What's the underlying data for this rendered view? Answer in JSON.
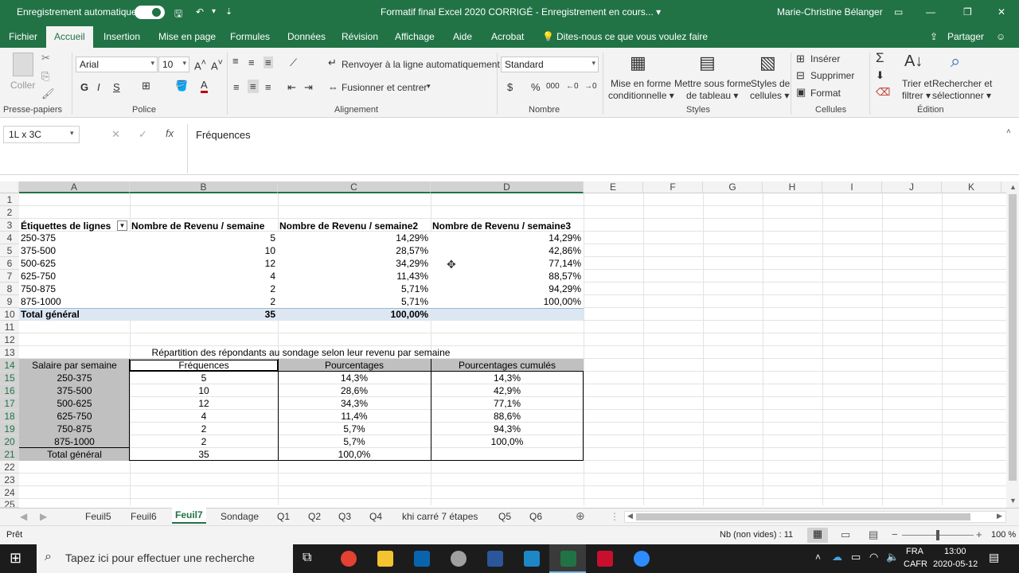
{
  "titlebar": {
    "autosave": "Enregistrement automatique",
    "doc_title": "Formatif final Excel 2020 CORRIGÉ  -  Enregistrement en cours...  ▾",
    "user": "Marie-Christine Bélanger"
  },
  "menu": [
    "Fichier",
    "Accueil",
    "Insertion",
    "Mise en page",
    "Formules",
    "Données",
    "Révision",
    "Affichage",
    "Aide",
    "Acrobat"
  ],
  "tellme": "Dites-nous ce que vous voulez faire",
  "share": "Partager",
  "ribbon": {
    "paste": "Coller",
    "font_name": "Arial",
    "font_size": "10",
    "wrap": "Renvoyer à la ligne automatiquement",
    "merge": "Fusionner et centrer",
    "number_format": "Standard",
    "cond_format": [
      "Mise en forme",
      "conditionnelle ▾"
    ],
    "table_format": [
      "Mettre sous forme",
      "de tableau ▾"
    ],
    "cell_styles": [
      "Styles de",
      "cellules ▾"
    ],
    "insert": "Insérer",
    "delete": "Supprimer",
    "format": "Format",
    "sort": [
      "Trier et",
      "filtrer ▾"
    ],
    "find": [
      "Rechercher et",
      "sélectionner ▾"
    ],
    "groups": [
      "Presse-papiers",
      "Police",
      "Alignement",
      "Nombre",
      "Styles",
      "Cellules",
      "Édition"
    ]
  },
  "formula_bar": {
    "name_box": "1L x 3C",
    "content": "Fréquences"
  },
  "columns": [
    "A",
    "B",
    "C",
    "D",
    "E",
    "F",
    "G",
    "H",
    "I",
    "J",
    "K"
  ],
  "rows": [
    "1",
    "2",
    "3",
    "4",
    "5",
    "6",
    "7",
    "8",
    "9",
    "10",
    "11",
    "12",
    "13",
    "14",
    "15",
    "16",
    "17",
    "18",
    "19",
    "20",
    "21",
    "22",
    "23",
    "24",
    "25"
  ],
  "pivot": {
    "headers": [
      "Étiquettes de lignes",
      "Nombre de Revenu / semaine",
      "Nombre de Revenu / semaine2",
      "Nombre de Revenu / semaine3"
    ],
    "rows": [
      [
        "250-375",
        "5",
        "14,29%",
        "14,29%"
      ],
      [
        "375-500",
        "10",
        "28,57%",
        "42,86%"
      ],
      [
        "500-625",
        "12",
        "34,29%",
        "77,14%"
      ],
      [
        "625-750",
        "4",
        "11,43%",
        "88,57%"
      ],
      [
        "750-875",
        "2",
        "5,71%",
        "94,29%"
      ],
      [
        "875-1000",
        "2",
        "5,71%",
        "100,00%"
      ]
    ],
    "total": [
      "Total général",
      "35",
      "100,00%",
      ""
    ]
  },
  "table": {
    "title": "Répartition des répondants au sondage selon leur revenu par semaine",
    "headers": [
      "Salaire par semaine",
      "Fréquences",
      "Pourcentages",
      "Pourcentages cumulés"
    ],
    "rows": [
      [
        "250-375",
        "5",
        "14,3%",
        "14,3%"
      ],
      [
        "375-500",
        "10",
        "28,6%",
        "42,9%"
      ],
      [
        "500-625",
        "12",
        "34,3%",
        "77,1%"
      ],
      [
        "625-750",
        "4",
        "11,4%",
        "88,6%"
      ],
      [
        "750-875",
        "2",
        "5,7%",
        "94,3%"
      ],
      [
        "875-1000",
        "2",
        "5,7%",
        "100,0%"
      ]
    ],
    "total": [
      "Total général",
      "35",
      "100,0%",
      ""
    ]
  },
  "sheets": [
    "Feuil5",
    "Feuil6",
    "Feuil7",
    "Sondage",
    "Q1",
    "Q2",
    "Q3",
    "Q4",
    "khi carré 7 étapes",
    "Q5",
    "Q6"
  ],
  "status": {
    "ready": "Prêt",
    "count": "Nb (non vides) : 11",
    "zoom": "100 %"
  },
  "taskbar": {
    "search": "Tapez ici pour effectuer une recherche",
    "lang1": "FRA",
    "lang2": "CAFR",
    "time": "13:00",
    "date": "2020-05-12"
  }
}
